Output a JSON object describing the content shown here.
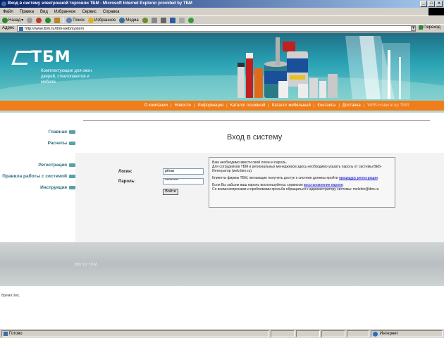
{
  "window": {
    "title": "Вход в систему электронной торговли ТБМ - Microsoft Internet Explorer provided by ТБМ",
    "min": "_",
    "max": "□",
    "close": "×"
  },
  "menu": [
    "Файл",
    "Правка",
    "Вид",
    "Избранное",
    "Сервис",
    "Справка"
  ],
  "toolbar": {
    "back": "Назад",
    "search": "Поиск",
    "favorites": "Избранное",
    "media": "Медиа"
  },
  "address": {
    "label": "Адрес",
    "url": "http://www.tbm.ru/tbm-web/system",
    "go": "Переход"
  },
  "banner": {
    "logo": "ТБМ",
    "tagline": "Комплектующие для окон, дверей, стеклопакетов и мебели."
  },
  "nav": [
    "О компании",
    "Новости",
    "Информация",
    "Каталог основной",
    "Каталог мебельный",
    "Контакты",
    "Доставка",
    "WEB-Навигатор ТБМ"
  ],
  "sidebar": [
    "Главная",
    "Расчеты",
    "Регистрация",
    "Правила работы с системой",
    "Инструкция"
  ],
  "page": {
    "title": "Вход в систему",
    "login_label": "Логин:",
    "login_value": "pilnar",
    "password_label": "Пароль:",
    "password_value": "*********",
    "submit": "Войти"
  },
  "info": {
    "p1a": "Вам необходимо ввести свой логин и пароль.",
    "p1b": "Для сотрудников ТБМ и региональных менеджеров здесь необходимо указать пароль от системы ВЕБ-Интегратор (web.tbm.ru).",
    "p2a": "Клиенты фирмы ТБМ, желающие получить доступ к системе должны пройти ",
    "p2link": "процедуру регистрации",
    "p3a": "Если Вы забыли ваш пароль воспользуйтесь сервисом ",
    "p3link": "восстановления пароля",
    "p3b": "Со всеми вопросами и проблемами просьба обращаться к администратору системы: melehin@tbm.ru"
  },
  "footer": {
    "copyright": "2007 (c) Т.Б.М.",
    "timing": "Время 0мс."
  },
  "status": {
    "done": "Готово",
    "zone": "Интернет"
  },
  "colors": {
    "nav_orange": "#f07d1a",
    "banner_teal": "#2aa3b5",
    "sidebar_link": "#2b6d7a"
  }
}
